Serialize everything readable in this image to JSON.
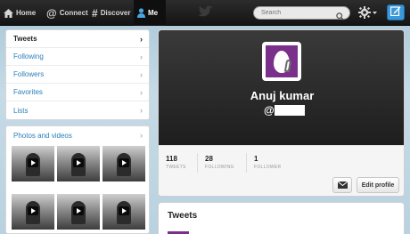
{
  "nav": {
    "home": "Home",
    "connect": "Connect",
    "discover": "Discover",
    "me": "Me"
  },
  "search": {
    "placeholder": "Search"
  },
  "sidebar": {
    "items": [
      {
        "label": "Tweets",
        "active": true
      },
      {
        "label": "Following",
        "active": false
      },
      {
        "label": "Followers",
        "active": false
      },
      {
        "label": "Favorites",
        "active": false
      },
      {
        "label": "Lists",
        "active": false
      }
    ]
  },
  "media": {
    "title": "Photos and videos"
  },
  "profile": {
    "name": "Anuj kumar",
    "handle_prefix": "@",
    "stats": {
      "tweets_count": "118",
      "tweets_label": "TWEETS",
      "following_count": "28",
      "following_label": "FOLLOWING",
      "followers_count": "1",
      "followers_label": "FOLLOWER"
    },
    "edit_label": "Edit profile"
  },
  "timeline": {
    "title": "Tweets"
  },
  "colors": {
    "accent": "#3a98d8",
    "link": "#2a7fb8",
    "avatar_bg": "#7a2f8a",
    "topbar": "#1b1b1b"
  }
}
